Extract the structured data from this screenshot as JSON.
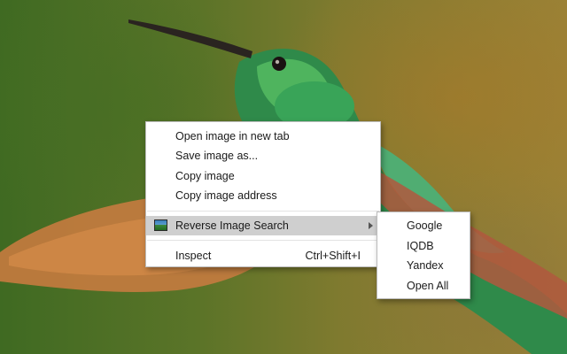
{
  "context_menu": {
    "items": [
      {
        "label": "Open image in new tab"
      },
      {
        "label": "Save image as..."
      },
      {
        "label": "Copy image"
      },
      {
        "label": "Copy image address"
      },
      {
        "label": "Reverse Image Search",
        "icon": "picture-icon",
        "has_submenu": true,
        "highlighted": true
      },
      {
        "label": "Inspect",
        "shortcut": "Ctrl+Shift+I"
      }
    ]
  },
  "submenu": {
    "items": [
      {
        "label": "Google"
      },
      {
        "label": "IQDB"
      },
      {
        "label": "Yandex"
      },
      {
        "label": "Open All"
      }
    ]
  },
  "colors": {
    "menu_bg": "#ffffff",
    "highlight": "#cfcfcf",
    "text": "#1a1a1a"
  }
}
